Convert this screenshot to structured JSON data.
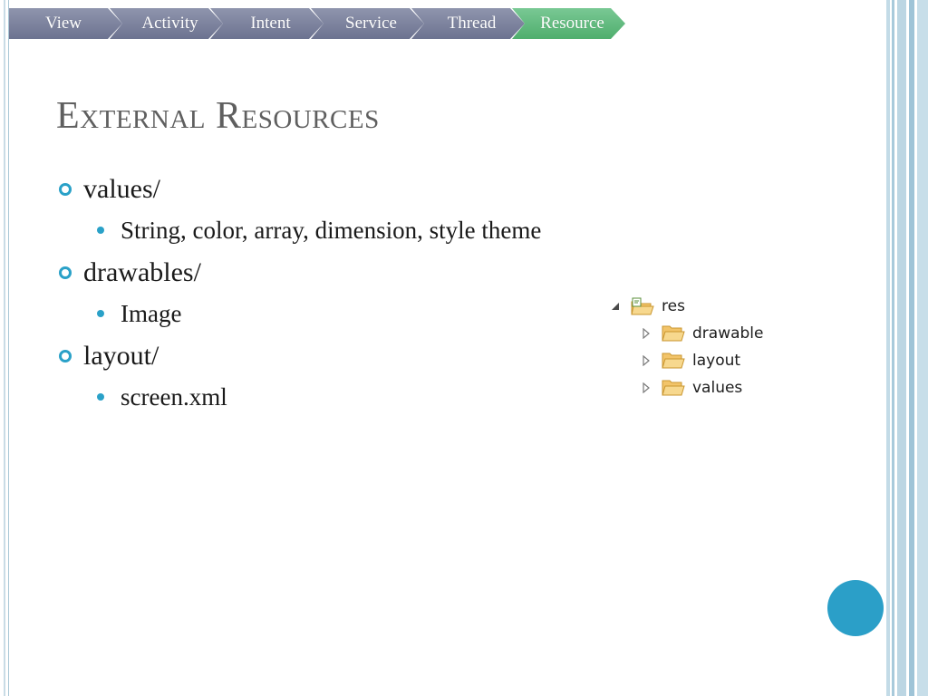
{
  "breadcrumb": {
    "items": [
      {
        "label": "View"
      },
      {
        "label": "Activity"
      },
      {
        "label": "Intent"
      },
      {
        "label": "Service"
      },
      {
        "label": "Thread"
      },
      {
        "label": "Resource"
      }
    ],
    "active_index": 5
  },
  "slide": {
    "title": "External Resources",
    "bullets": [
      {
        "label": "values/",
        "sub": "String, color, array, dimension, style theme"
      },
      {
        "label": "drawables/",
        "sub": "Image"
      },
      {
        "label": "layout/",
        "sub": "screen.xml"
      }
    ]
  },
  "tree": {
    "root": {
      "label": "res",
      "icon": "resource-folder-icon",
      "expanded": true
    },
    "children": [
      {
        "label": "drawable",
        "icon": "folder-icon"
      },
      {
        "label": "layout",
        "icon": "folder-icon"
      },
      {
        "label": "values",
        "icon": "folder-icon"
      }
    ]
  },
  "colors": {
    "accent": "#2aa1c8",
    "crumb_inactive": "#7a809b",
    "crumb_active": "#5cb87b",
    "title": "#5f5f5f"
  }
}
